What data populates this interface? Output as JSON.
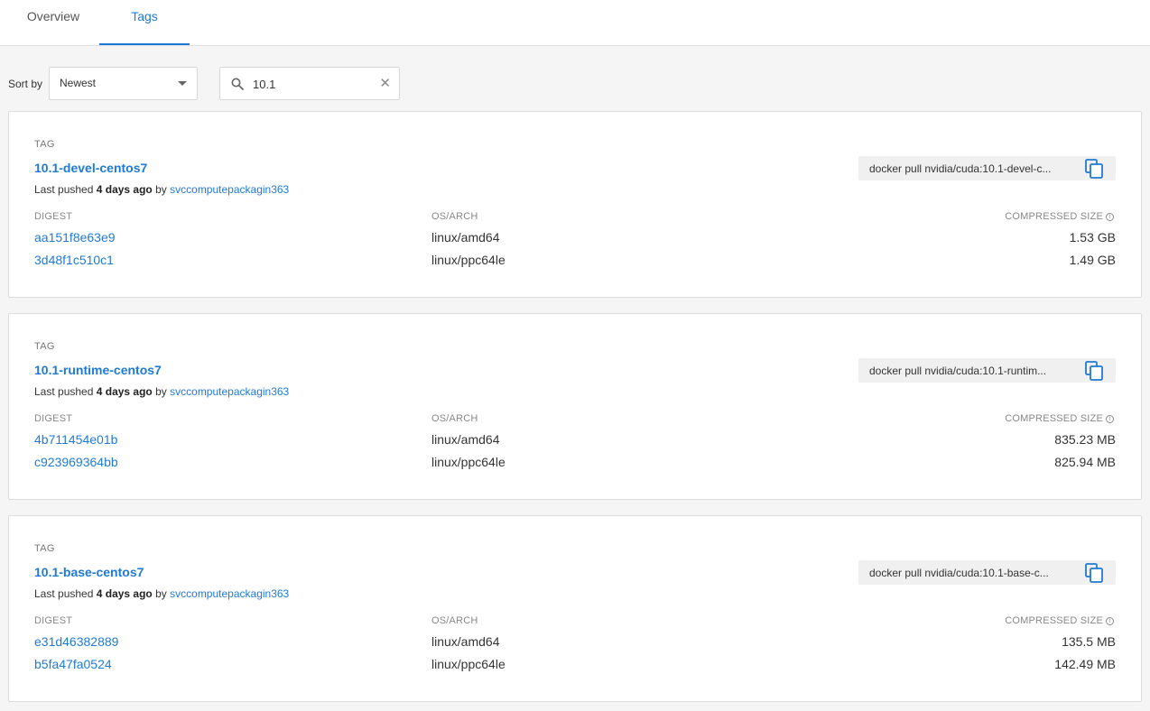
{
  "tabs": [
    {
      "label": "Overview",
      "active": false
    },
    {
      "label": "Tags",
      "active": true
    }
  ],
  "toolbar": {
    "sort_label": "Sort by",
    "sort_value": "Newest",
    "search_value": "10.1"
  },
  "columns": {
    "tag": "TAG",
    "digest": "DIGEST",
    "osarch": "OS/ARCH",
    "size": "COMPRESSED SIZE"
  },
  "pushed_prefix": "Last pushed",
  "pushed_by": "by",
  "tags": [
    {
      "name": "10.1-devel-centos7",
      "ago": "4 days ago",
      "user": "svccomputepackagin363",
      "pull": "docker pull nvidia/cuda:10.1-devel-c...",
      "images": [
        {
          "digest": "aa151f8e63e9",
          "os": "linux/amd64",
          "size": "1.53 GB"
        },
        {
          "digest": "3d48f1c510c1",
          "os": "linux/ppc64le",
          "size": "1.49 GB"
        }
      ]
    },
    {
      "name": "10.1-runtime-centos7",
      "ago": "4 days ago",
      "user": "svccomputepackagin363",
      "pull": "docker pull nvidia/cuda:10.1-runtim...",
      "images": [
        {
          "digest": "4b711454e01b",
          "os": "linux/amd64",
          "size": "835.23 MB"
        },
        {
          "digest": "c923969364bb",
          "os": "linux/ppc64le",
          "size": "825.94 MB"
        }
      ]
    },
    {
      "name": "10.1-base-centos7",
      "ago": "4 days ago",
      "user": "svccomputepackagin363",
      "pull": "docker pull nvidia/cuda:10.1-base-c...",
      "images": [
        {
          "digest": "e31d46382889",
          "os": "linux/amd64",
          "size": "135.5 MB"
        },
        {
          "digest": "b5fa47fa0524",
          "os": "linux/ppc64le",
          "size": "142.49 MB"
        }
      ]
    }
  ],
  "colors": {
    "accent": "#1f7ad6",
    "page_bg": "#f5f5f5",
    "card_bg": "#ffffff"
  },
  "icons": {
    "search": "search-icon",
    "clear": "close-icon",
    "copy": "copy-icon",
    "info": "info-icon",
    "caret": "chevron-down-icon"
  }
}
